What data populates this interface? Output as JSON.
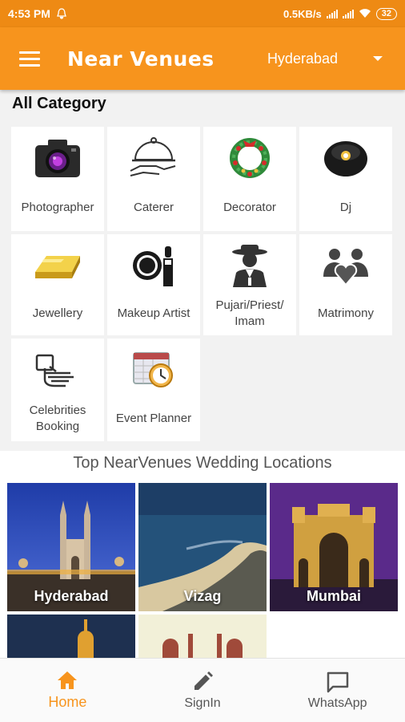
{
  "status_bar": {
    "time": "4:53 PM",
    "speed": "0.5KB/s",
    "battery": "32"
  },
  "app_bar": {
    "title": "Near Venues",
    "city": "Hyderabad"
  },
  "categories": {
    "heading": "All Category",
    "items": [
      {
        "label": "Photographer",
        "icon": "camera-icon"
      },
      {
        "label": "Caterer",
        "icon": "serving-cloche-icon"
      },
      {
        "label": "Decorator",
        "icon": "wreath-icon"
      },
      {
        "label": "Dj",
        "icon": "speaker-ball-icon"
      },
      {
        "label": "Jewellery",
        "icon": "gold-bar-icon"
      },
      {
        "label": "Makeup Artist",
        "icon": "makeup-icon"
      },
      {
        "label": "Pujari/Priest/ Imam",
        "icon": "priest-icon"
      },
      {
        "label": "Matrimony",
        "icon": "couple-heart-icon"
      },
      {
        "label": "Celebrities Booking",
        "icon": "booking-hand-icon"
      },
      {
        "label": "Event Planner",
        "icon": "calendar-clock-icon"
      }
    ]
  },
  "locations": {
    "heading": "Top NearVenues Wedding Locations",
    "items": [
      {
        "name": "Hyderabad"
      },
      {
        "name": "Vizag"
      },
      {
        "name": "Mumbai"
      },
      {
        "name": ""
      },
      {
        "name": ""
      }
    ]
  },
  "bottom_nav": {
    "items": [
      {
        "label": "Home",
        "icon": "home-icon",
        "active": true
      },
      {
        "label": "SignIn",
        "icon": "pencil-icon",
        "active": false
      },
      {
        "label": "WhatsApp",
        "icon": "chat-bubble-icon",
        "active": false
      }
    ]
  },
  "colors": {
    "primary": "#f7941d",
    "status_bar": "#ee8a14"
  }
}
